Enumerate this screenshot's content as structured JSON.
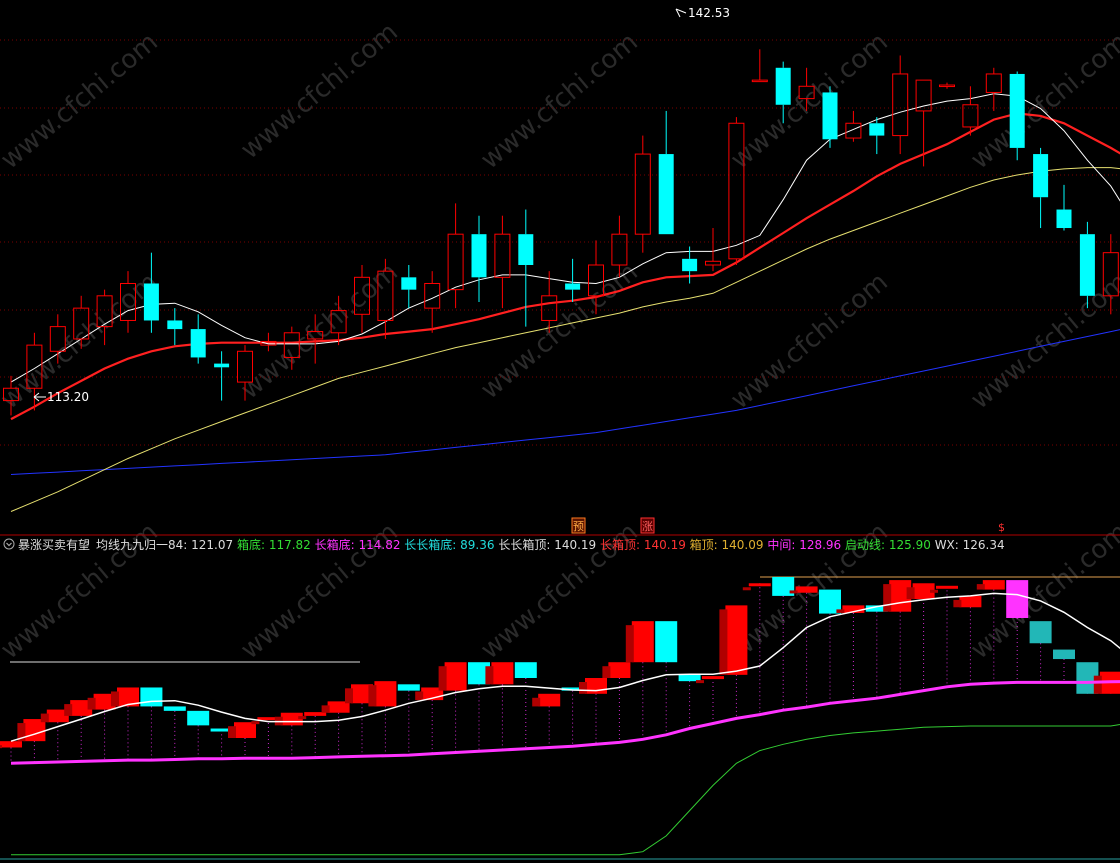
{
  "colors": {
    "background": "#000000",
    "up": "#ff0000",
    "down": "#00ffff",
    "gridline": "#7a0000",
    "ma_white": "#ffffff",
    "ma_red": "#ff2020",
    "ma_yellow": "#e6e070",
    "ma_blue": "#2233ff",
    "box_bottom_line": "#ff33ff",
    "start_line": "#33cc33",
    "dark_red": "#b00000",
    "teal": "#22b7b7",
    "magenta": "#ff33ff"
  },
  "watermark": "www.cfchi.com",
  "price_panel": {
    "high_label": "142.53",
    "low_label": "113.20",
    "signals": [
      {
        "label": "预"
      },
      {
        "label": "涨"
      },
      {
        "label": "$"
      }
    ]
  },
  "indicator_header": {
    "menu_icon": "circle-chevron-icon",
    "name": "暴涨买卖有望",
    "items": [
      {
        "label": "均线九九归一84:",
        "value": "121.07",
        "color": "#dddddd"
      },
      {
        "label": "箱底:",
        "value": "117.82",
        "color": "#33dd33"
      },
      {
        "label": "长箱底:",
        "value": "114.82",
        "color": "#ff33ff"
      },
      {
        "label": "长长箱底:",
        "value": "89.36",
        "color": "#22dddd"
      },
      {
        "label": "长长箱顶:",
        "value": "140.19",
        "color": "#dddddd"
      },
      {
        "label": "长箱顶:",
        "value": "140.19",
        "color": "#ff3333"
      },
      {
        "label": "箱顶:",
        "value": "140.09",
        "color": "#e0b030"
      },
      {
        "label": "中间:",
        "value": "128.96",
        "color": "#ff33ff"
      },
      {
        "label": "启动线:",
        "value": "125.90",
        "color": "#33dd33"
      },
      {
        "label": "WX:",
        "value": "126.34",
        "color": "#dddddd"
      }
    ]
  },
  "chart_data": {
    "type": "candlestick",
    "ylim": [
      103.5,
      146.5
    ],
    "candles": [
      {
        "o": 114.0,
        "h": 116.0,
        "l": 112.8,
        "c": 115.0
      },
      {
        "o": 115.0,
        "h": 119.5,
        "l": 113.2,
        "c": 118.5
      },
      {
        "o": 118.0,
        "h": 121.0,
        "l": 117.0,
        "c": 120.0
      },
      {
        "o": 119.0,
        "h": 122.5,
        "l": 118.2,
        "c": 121.5
      },
      {
        "o": 120.0,
        "h": 123.0,
        "l": 118.5,
        "c": 122.5
      },
      {
        "o": 120.5,
        "h": 124.5,
        "l": 119.5,
        "c": 123.5
      },
      {
        "o": 123.5,
        "h": 126.0,
        "l": 119.5,
        "c": 120.5
      },
      {
        "o": 120.5,
        "h": 121.5,
        "l": 118.5,
        "c": 119.8
      },
      {
        "o": 119.8,
        "h": 121.0,
        "l": 117.0,
        "c": 117.5
      },
      {
        "o": 117.0,
        "h": 118.0,
        "l": 114.0,
        "c": 116.7
      },
      {
        "o": 115.5,
        "h": 118.5,
        "l": 114.0,
        "c": 118.0
      },
      {
        "o": 118.5,
        "h": 119.5,
        "l": 118.0,
        "c": 118.8
      },
      {
        "o": 117.5,
        "h": 120.0,
        "l": 116.5,
        "c": 119.5
      },
      {
        "o": 119.0,
        "h": 121.0,
        "l": 117.0,
        "c": 119.6
      },
      {
        "o": 119.5,
        "h": 122.5,
        "l": 118.5,
        "c": 121.3
      },
      {
        "o": 121.0,
        "h": 125.0,
        "l": 119.5,
        "c": 124.0
      },
      {
        "o": 120.5,
        "h": 125.5,
        "l": 119.0,
        "c": 124.5
      },
      {
        "o": 124.0,
        "h": 125.0,
        "l": 121.5,
        "c": 123.0
      },
      {
        "o": 121.5,
        "h": 124.5,
        "l": 119.5,
        "c": 123.5
      },
      {
        "o": 123.0,
        "h": 130.0,
        "l": 121.5,
        "c": 127.5
      },
      {
        "o": 127.5,
        "h": 129.0,
        "l": 122.0,
        "c": 124.0
      },
      {
        "o": 124.0,
        "h": 129.0,
        "l": 121.5,
        "c": 127.5
      },
      {
        "o": 127.5,
        "h": 129.5,
        "l": 120.0,
        "c": 125.0
      },
      {
        "o": 120.5,
        "h": 124.5,
        "l": 119.5,
        "c": 122.5
      },
      {
        "o": 123.5,
        "h": 125.5,
        "l": 122.0,
        "c": 123.0
      },
      {
        "o": 122.5,
        "h": 127.0,
        "l": 121.0,
        "c": 125.0
      },
      {
        "o": 125.0,
        "h": 129.0,
        "l": 124.0,
        "c": 127.5
      },
      {
        "o": 127.5,
        "h": 135.5,
        "l": 126.0,
        "c": 134.0
      },
      {
        "o": 134.0,
        "h": 137.5,
        "l": 127.5,
        "c": 127.5
      },
      {
        "o": 125.5,
        "h": 126.5,
        "l": 123.5,
        "c": 124.5
      },
      {
        "o": 125.0,
        "h": 128.0,
        "l": 124.5,
        "c": 125.3
      },
      {
        "o": 125.5,
        "h": 137.0,
        "l": 125.0,
        "c": 136.5
      },
      {
        "o": 140.0,
        "h": 142.5,
        "l": 140.0,
        "c": 140.0
      },
      {
        "o": 141.0,
        "h": 141.5,
        "l": 136.5,
        "c": 138.0
      },
      {
        "o": 138.5,
        "h": 141.0,
        "l": 137.5,
        "c": 139.5
      },
      {
        "o": 139.0,
        "h": 139.5,
        "l": 134.5,
        "c": 135.2
      },
      {
        "o": 135.3,
        "h": 137.5,
        "l": 135.0,
        "c": 136.5
      },
      {
        "o": 136.5,
        "h": 137.0,
        "l": 134.0,
        "c": 135.5
      },
      {
        "o": 135.5,
        "h": 142.0,
        "l": 134.0,
        "c": 140.5
      },
      {
        "o": 137.5,
        "h": 140.0,
        "l": 133.0,
        "c": 140.0
      },
      {
        "o": 139.5,
        "h": 139.8,
        "l": 139.3,
        "c": 139.6
      },
      {
        "o": 136.2,
        "h": 139.5,
        "l": 135.5,
        "c": 138.0
      },
      {
        "o": 139.0,
        "h": 141.0,
        "l": 137.5,
        "c": 140.5
      },
      {
        "o": 140.5,
        "h": 140.7,
        "l": 133.5,
        "c": 134.5
      },
      {
        "o": 134.0,
        "h": 134.5,
        "l": 128.0,
        "c": 130.5
      },
      {
        "o": 129.5,
        "h": 131.5,
        "l": 127.8,
        "c": 128.0
      },
      {
        "o": 127.5,
        "h": 128.5,
        "l": 121.5,
        "c": 122.5
      },
      {
        "o": 122.5,
        "h": 127.5,
        "l": 121.0,
        "c": 126.0
      },
      {
        "o": 124.0,
        "h": 126.5,
        "l": 122.5,
        "c": 123.0
      },
      {
        "o": 123.0,
        "h": 123.5,
        "l": 117.0,
        "c": 118.5
      },
      {
        "o": 118.5,
        "h": 123.5,
        "l": 117.5,
        "c": 118.8
      },
      {
        "o": 119.5,
        "h": 125.0,
        "l": 118.5,
        "c": 123.5
      },
      {
        "o": 123.5,
        "h": 125.0,
        "l": 121.0,
        "c": 121.0
      }
    ],
    "ma_white": [
      115.5,
      116.6,
      117.8,
      119.0,
      120.2,
      121.3,
      121.8,
      121.9,
      121.2,
      120.1,
      119.1,
      118.6,
      118.6,
      118.6,
      118.8,
      119.4,
      120.4,
      121.5,
      122.3,
      123.2,
      123.8,
      124.2,
      124.2,
      123.9,
      123.6,
      123.5,
      124.0,
      125.1,
      126.0,
      126.1,
      126.1,
      126.6,
      127.4,
      130.3,
      133.5,
      135.2,
      136.0,
      136.8,
      137.4,
      137.9,
      138.3,
      138.5,
      138.9,
      138.7,
      137.7,
      135.9,
      133.5,
      131.4,
      128.4,
      126.1,
      124.3,
      123.2,
      123.0
    ],
    "ma_red": [
      112.5,
      113.5,
      114.6,
      115.6,
      116.6,
      117.4,
      118.0,
      118.4,
      118.6,
      118.7,
      118.7,
      118.7,
      118.7,
      118.8,
      118.9,
      119.1,
      119.4,
      119.6,
      119.8,
      120.2,
      120.6,
      121.1,
      121.6,
      121.9,
      122.1,
      122.4,
      122.9,
      123.6,
      124.0,
      124.1,
      124.2,
      125.2,
      126.4,
      127.6,
      128.8,
      129.9,
      131.0,
      132.2,
      133.2,
      134.0,
      134.8,
      135.8,
      136.8,
      137.3,
      137.1,
      136.5,
      135.5,
      134.5,
      133.4,
      132.4,
      131.5,
      130.6,
      129.7
    ],
    "ma_yellow": [
      105.0,
      105.8,
      106.6,
      107.5,
      108.4,
      109.3,
      110.1,
      110.9,
      111.6,
      112.3,
      113.0,
      113.7,
      114.4,
      115.1,
      115.8,
      116.3,
      116.8,
      117.3,
      117.8,
      118.3,
      118.7,
      119.1,
      119.5,
      119.9,
      120.3,
      120.7,
      121.1,
      121.6,
      122.0,
      122.3,
      122.7,
      123.6,
      124.5,
      125.4,
      126.3,
      127.1,
      127.8,
      128.5,
      129.2,
      129.9,
      130.6,
      131.3,
      131.9,
      132.3,
      132.6,
      132.8,
      132.9,
      132.9,
      132.7,
      132.4,
      132.2,
      132.0,
      131.9
    ],
    "ma_blue": [
      108.0,
      108.1,
      108.2,
      108.3,
      108.4,
      108.5,
      108.6,
      108.7,
      108.8,
      108.9,
      109.0,
      109.1,
      109.2,
      109.3,
      109.4,
      109.5,
      109.6,
      109.8,
      110.0,
      110.2,
      110.4,
      110.6,
      110.8,
      111.0,
      111.2,
      111.4,
      111.7,
      112.0,
      112.3,
      112.6,
      112.9,
      113.2,
      113.6,
      114.0,
      114.4,
      114.8,
      115.2,
      115.6,
      116.0,
      116.4,
      116.8,
      117.2,
      117.6,
      118.0,
      118.4,
      118.8,
      119.2,
      119.6,
      120.0,
      120.4,
      120.8,
      121.2,
      121.6
    ],
    "indicator": {
      "box_bottom": [
        111.5,
        111.6,
        111.7,
        111.8,
        111.9,
        112.0,
        112.0,
        112.1,
        112.2,
        112.2,
        112.3,
        112.3,
        112.3,
        112.4,
        112.5,
        112.6,
        112.7,
        112.8,
        113.0,
        113.2,
        113.4,
        113.6,
        113.8,
        114.0,
        114.2,
        114.5,
        114.8,
        115.3,
        116.0,
        117.0,
        117.8,
        118.6,
        119.2,
        119.9,
        120.4,
        121.0,
        121.4,
        121.8,
        122.4,
        123.0,
        123.6,
        124.0,
        124.2,
        124.3,
        124.3,
        124.3,
        124.3,
        124.4,
        124.5,
        124.6,
        124.7,
        124.8,
        124.8
      ],
      "start_line": [
        97.0,
        97.0,
        97.0,
        97.0,
        97.0,
        97.0,
        97.0,
        97.0,
        97.0,
        97.0,
        97.0,
        97.0,
        97.0,
        97.0,
        97.0,
        97.0,
        97.0,
        97.0,
        97.0,
        97.0,
        97.0,
        97.0,
        97.0,
        97.0,
        97.0,
        97.0,
        97.0,
        97.5,
        100.0,
        104.0,
        108.0,
        111.5,
        113.5,
        114.5,
        115.3,
        115.9,
        116.3,
        116.6,
        116.9,
        117.2,
        117.3,
        117.4,
        117.4,
        117.4,
        117.4,
        117.4,
        117.4,
        117.4,
        118.0,
        118.8,
        119.2,
        119.6,
        120.0
      ],
      "box_top_line": 141.0,
      "ylim": [
        96.5,
        144.0
      ]
    }
  }
}
